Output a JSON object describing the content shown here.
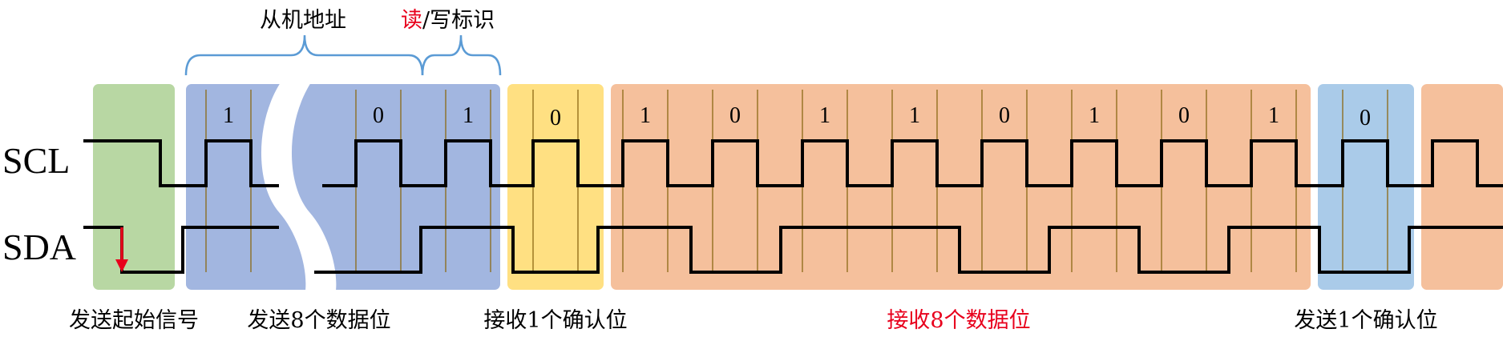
{
  "signals": {
    "scl": "SCL",
    "sda": "SDA"
  },
  "braces": {
    "slave_address": "从机地址",
    "read_mark": "读",
    "write_mark": "/写标识"
  },
  "captions": {
    "start": "发送起始信号",
    "send_data": "发送8个数据位",
    "recv_ack": "接收1个确认位",
    "recv_data": "接收8个数据位",
    "send_ack": "发送1个确认位"
  },
  "bits": {
    "address": [
      "1",
      "0",
      "1"
    ],
    "ack1": "0",
    "data": [
      "1",
      "0",
      "1",
      "1",
      "0",
      "1",
      "0",
      "1"
    ],
    "ack2": "0"
  },
  "colors": {
    "start_green": "#b8d7a3",
    "address_blue": "#a2b6e0",
    "ack_yellow": "#ffe082",
    "data_orange": "#f5c09c",
    "ack_lightblue": "#aacbe9",
    "brace_blue": "#5b9bd5",
    "emphasis_red": "#e8001c",
    "tick_gold": "#8b6914"
  }
}
